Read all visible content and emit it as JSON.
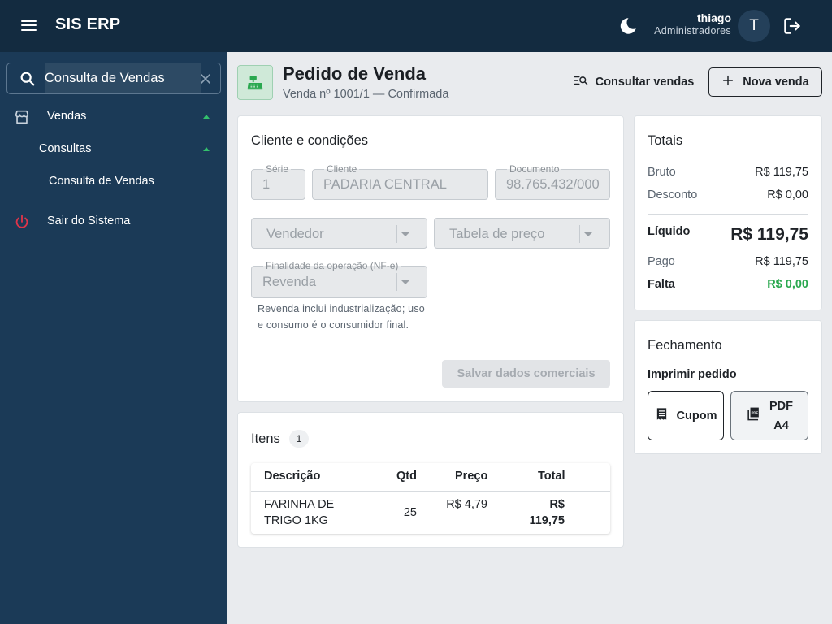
{
  "app": {
    "title": "SIS ERP"
  },
  "user": {
    "name": "thiago",
    "role": "Administradores",
    "initial": "T"
  },
  "sidebar": {
    "search_value": "Consulta de Vendas",
    "items": [
      {
        "label": "Vendas"
      },
      {
        "label": "Consultas"
      },
      {
        "label": "Consulta de Vendas"
      },
      {
        "label": "Sair do Sistema"
      }
    ]
  },
  "header": {
    "title": "Pedido de Venda",
    "subtitle": "Venda nº 1001/1 — Confirmada",
    "consult_label": "Consultar vendas",
    "new_label": "Nova venda"
  },
  "client": {
    "title": "Cliente e condições",
    "serie_label": "Série",
    "serie_value": "1",
    "cliente_label": "Cliente",
    "cliente_value": "PADARIA CENTRAL",
    "documento_label": "Documento",
    "documento_value": "98.765.432/000",
    "vendedor_placeholder": "Vendedor",
    "tabela_placeholder": "Tabela de preço",
    "finalidade_label": "Finalidade da operação (NF-e)",
    "finalidade_value": "Revenda",
    "help": "Revenda inclui industrialização; uso e consumo é o consumidor final.",
    "save_label": "Salvar dados comerciais"
  },
  "items": {
    "title": "Itens",
    "count": "1",
    "columns": [
      "Descrição",
      "Qtd",
      "Preço",
      "Total"
    ],
    "rows": [
      {
        "descricao": "FARINHA DE TRIGO 1KG",
        "qtd": "25",
        "preco": "R$ 4,79",
        "total": "R$ 119,75"
      }
    ]
  },
  "totals": {
    "title": "Totais",
    "bruto_label": "Bruto",
    "bruto_value": "R$ 119,75",
    "desconto_label": "Desconto",
    "desconto_value": "R$ 0,00",
    "liquido_label": "Líquido",
    "liquido_value": "R$ 119,75",
    "pago_label": "Pago",
    "pago_value": "R$ 119,75",
    "falta_label": "Falta",
    "falta_value": "R$ 0,00"
  },
  "closing": {
    "title": "Fechamento",
    "print_label": "Imprimir pedido",
    "cupom_label": "Cupom",
    "pdf_label": "PDF A4"
  },
  "colors": {
    "topbar": "#132b40",
    "sidebar": "#1b3a57",
    "accent_green": "#2aa84f",
    "logout_red": "#e0344a"
  },
  "icons": {
    "menu": "menu-icon",
    "theme": "moon-icon",
    "logout": "logout-icon",
    "search": "search-icon",
    "clear": "close-icon",
    "store": "store-icon",
    "power": "power-icon",
    "register": "cash-register-icon",
    "consult": "search-list-icon",
    "add": "plus-icon",
    "receipt": "receipt-icon",
    "pdf": "pdf-icon"
  }
}
